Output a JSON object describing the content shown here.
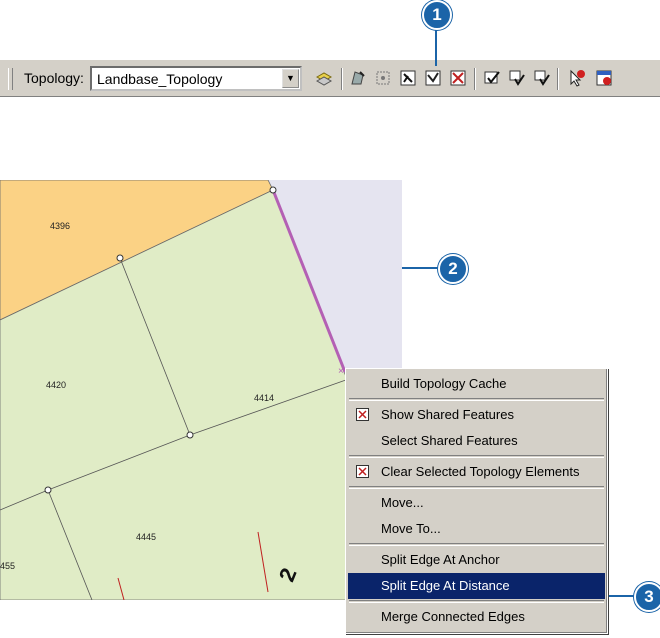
{
  "toolbar": {
    "label": "Topology:",
    "layer_value": "Landbase_Topology",
    "buttons": [
      {
        "icon": "build-cache-icon"
      },
      {
        "icon": "topology-edit-icon"
      },
      {
        "icon": "shared-features-icon"
      },
      {
        "icon": "topology-edit-tool-icon"
      },
      {
        "icon": "show-shared-features-icon"
      },
      {
        "icon": "validate-extent-icon"
      },
      {
        "icon": "validate-selection-icon"
      },
      {
        "icon": "validate-visible-icon"
      },
      {
        "icon": "fix-topology-error-icon"
      },
      {
        "icon": "error-inspector-icon"
      }
    ]
  },
  "callouts": {
    "one": "1",
    "two": "2",
    "three": "3"
  },
  "map": {
    "parcels": [
      "4396",
      "4420",
      "4414",
      "4445",
      "455"
    ],
    "street_fragment": "2",
    "colors": {
      "orange_parcel": "#fbd285",
      "green_parcel": "#e0ecc6",
      "lavender_parcel": "#e5e4f0",
      "selected_edge": "#b460b4"
    }
  },
  "context_menu": {
    "items": [
      {
        "label": "Build Topology Cache",
        "icon": ""
      },
      {
        "label": "Show Shared Features",
        "icon": "show-shared-features-icon"
      },
      {
        "label": "Select Shared Features",
        "icon": ""
      },
      {
        "label": "Clear Selected Topology Elements",
        "icon": "clear-selected-icon"
      },
      {
        "label": "Move...",
        "icon": ""
      },
      {
        "label": "Move To...",
        "icon": ""
      },
      {
        "label": "Split Edge At Anchor",
        "icon": ""
      },
      {
        "label": "Split Edge At Distance",
        "icon": "",
        "selected": true
      },
      {
        "label": "Merge Connected Edges",
        "icon": ""
      }
    ],
    "colors": {
      "selected_bg": "#0a246a",
      "menu_bg": "#d4d0c8"
    }
  },
  "accent": "#1b64a8"
}
